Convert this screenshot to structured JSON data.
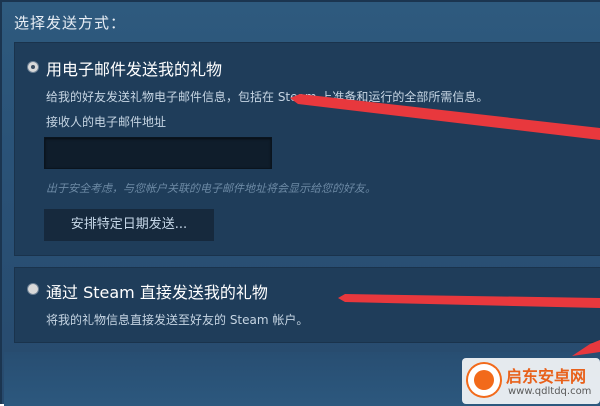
{
  "heading": "选择发送方式：",
  "email_option": {
    "title": "用电子邮件发送我的礼物",
    "description": "给我的好友发送礼物电子邮件信息，包括在 Steam 上准备和运行的全部所需信息。",
    "field_label": "接收人的电子邮件地址",
    "email_value": "",
    "hint": "出于安全考虑，与您帐户关联的电子邮件地址将会显示给您的好友。",
    "schedule_label": "安排特定日期发送..."
  },
  "steam_option": {
    "title": "通过 Steam 直接发送我的礼物",
    "description": "将我的礼物信息直接发送至好友的 Steam 帐户。"
  },
  "watermark": {
    "name": "启东安卓网",
    "url": "www.qdltdq.com"
  },
  "colors": {
    "panel": "#1f3d5a",
    "annotation_arrow": "#e8383d",
    "watermark_orange": "#f26a1b"
  }
}
